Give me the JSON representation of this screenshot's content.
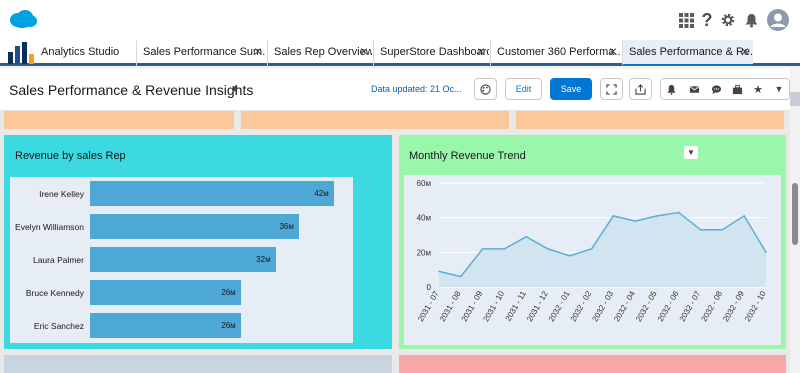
{
  "header": {
    "icons": [
      "waffle-icon",
      "help-icon",
      "gear-icon",
      "bell-icon",
      "avatar"
    ]
  },
  "app": {
    "name": "Analytics Studio"
  },
  "tabs": [
    {
      "label": "Sales Performance Sum...",
      "active": false
    },
    {
      "label": "Sales Rep Overview",
      "active": false
    },
    {
      "label": "SuperStore Dashboard",
      "active": false
    },
    {
      "label": "Customer 360 Performa...",
      "active": false
    },
    {
      "label": "Sales Performance & Re...",
      "active": true
    }
  ],
  "dashboard": {
    "title": "Sales Performance & Revenue Insights",
    "data_updated": "Data updated: 21 Oc...",
    "edit_label": "Edit",
    "save_label": "Save"
  },
  "colors": {
    "rep_panel_bg": "#3cd9e1",
    "trend_panel_bg": "#9af7aa",
    "bar_color": "#4ea8d6",
    "line_color": "#5aaedc",
    "strip_color": "#fbc89a",
    "bottom_left": "#c8d4e0",
    "bottom_right": "#f7a9a9"
  },
  "widgets": {
    "rep": {
      "title": "Revenue by sales Rep"
    },
    "trend": {
      "title": "Monthly Revenue Trend"
    }
  },
  "chart_data": [
    {
      "type": "bar",
      "title": "Revenue by sales Rep",
      "orientation": "horizontal",
      "categories": [
        "Irene Kelley",
        "Evelyn Williamson",
        "Laura Palmer",
        "Bruce Kennedy",
        "Eric Sanchez"
      ],
      "values": [
        42,
        36,
        32,
        26,
        26
      ],
      "value_labels": [
        "42м",
        "36м",
        "32м",
        "26м",
        "26м"
      ],
      "xlim": [
        0,
        44
      ]
    },
    {
      "type": "area",
      "title": "Monthly Revenue Trend",
      "categories": [
        "2031 - 07",
        "2031 - 08",
        "2031 - 09",
        "2031 - 10",
        "2031 - 11",
        "2031 - 12",
        "2032 - 01",
        "2032 - 02",
        "2032 - 03",
        "2032 - 04",
        "2032 - 05",
        "2032 - 06",
        "2032 - 07",
        "2032 - 08",
        "2032 - 09",
        "2032 - 10"
      ],
      "values": [
        9,
        6,
        22,
        22,
        29,
        22,
        18,
        22,
        41,
        38,
        41,
        43,
        33,
        33,
        41,
        20
      ],
      "ylim": [
        0,
        60
      ],
      "y_ticks": [
        "0",
        "20м",
        "40м",
        "60м"
      ],
      "grid": true
    }
  ]
}
